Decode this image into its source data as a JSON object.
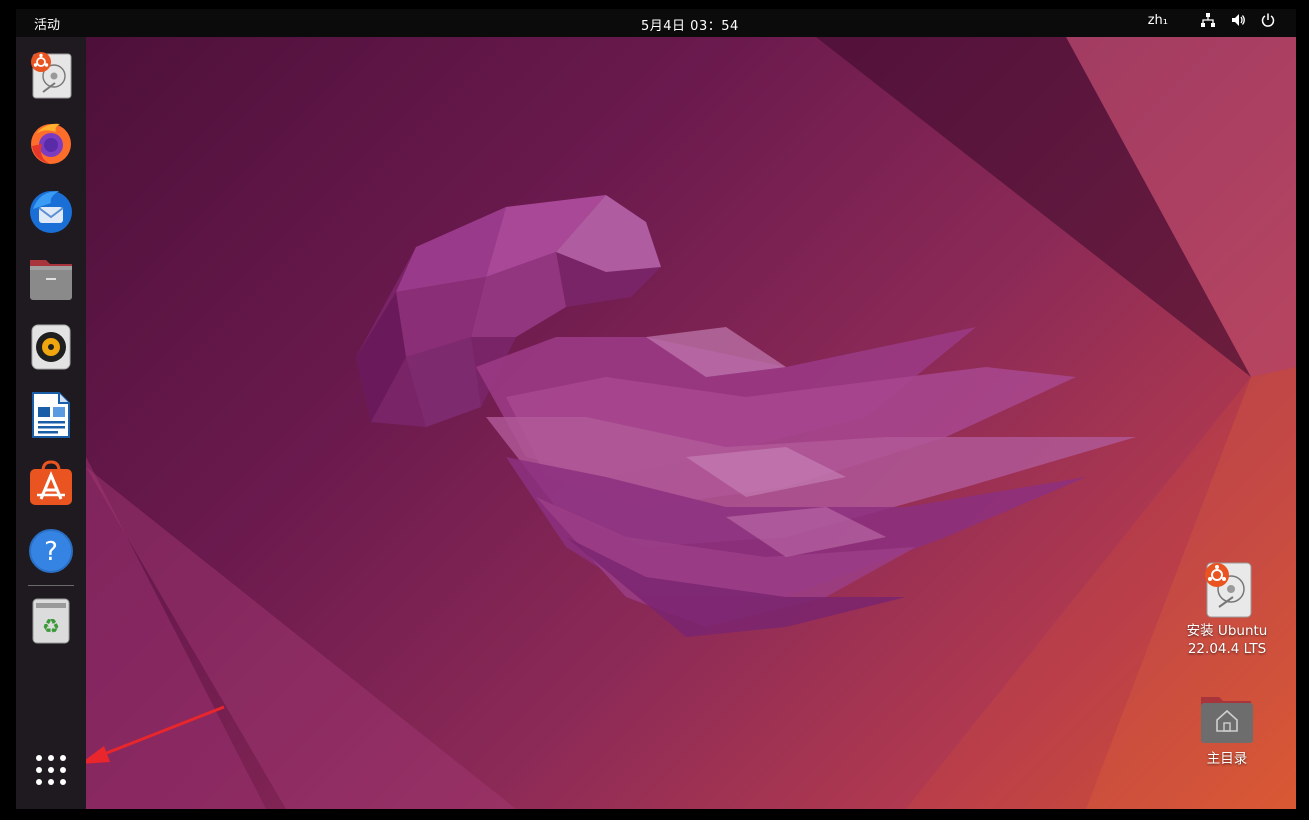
{
  "topbar": {
    "activities": "活动",
    "clock": "5月4日  03：54",
    "input_method": "zh₁",
    "tray_icons": [
      "network-icon",
      "volume-icon",
      "power-icon"
    ]
  },
  "dock": {
    "items": [
      {
        "name": "ubuntu-installer",
        "icon": "installer-icon"
      },
      {
        "name": "firefox",
        "icon": "firefox-icon"
      },
      {
        "name": "thunderbird",
        "icon": "thunderbird-icon"
      },
      {
        "name": "files",
        "icon": "files-icon"
      },
      {
        "name": "rhythmbox",
        "icon": "rhythmbox-icon"
      },
      {
        "name": "libreoffice-writer",
        "icon": "writer-icon"
      },
      {
        "name": "ubuntu-software",
        "icon": "software-icon"
      },
      {
        "name": "help",
        "icon": "help-icon"
      },
      {
        "name": "trash",
        "icon": "trash-icon"
      }
    ],
    "show_apps_icon": "grid-icon"
  },
  "desktop": {
    "icons": [
      {
        "label_line1": "安装 Ubuntu",
        "label_line2": "22.04.4 LTS",
        "icon": "installer-icon"
      },
      {
        "label": "主目录",
        "icon": "home-folder-icon"
      }
    ],
    "annotation": "red-arrow pointing to show-applications"
  },
  "colors": {
    "topbar": "#0b0b0b",
    "dock": "#1e1a1f",
    "wallpaper_dark": "#4a0f38",
    "wallpaper_mid": "#8c2a57",
    "wallpaper_warm": "#d9572f",
    "accent_orange": "#e95420",
    "arrow_red": "#e8262b"
  }
}
